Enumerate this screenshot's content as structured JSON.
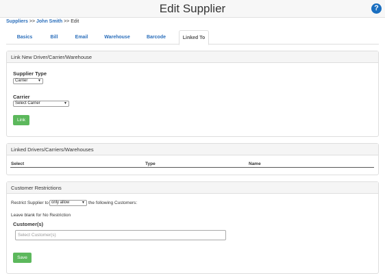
{
  "header": {
    "title": "Edit Supplier",
    "help_icon": "?"
  },
  "breadcrumb": {
    "root": "Suppliers",
    "sep1": ">>",
    "name": "John Smith",
    "sep2": ">> Edit"
  },
  "tabs": [
    {
      "label": "Basics"
    },
    {
      "label": "Bill"
    },
    {
      "label": "Email"
    },
    {
      "label": "Warehouse"
    },
    {
      "label": "Barcode"
    },
    {
      "label": "Linked To",
      "active": true
    }
  ],
  "link_panel": {
    "heading": "Link New Driver/Carrier/Warehouse",
    "supplier_type_label": "Supplier Type",
    "supplier_type_value": "Carrier",
    "carrier_label": "Carrier",
    "carrier_value": "Select Carrier",
    "link_button": "Link"
  },
  "linked_panel": {
    "heading": "Linked Drivers/Carriers/Warehouses",
    "columns": [
      "Select",
      "Type",
      "Name"
    ]
  },
  "restrictions_panel": {
    "heading": "Customer Restrictions",
    "prefix": "Restrict Supplier to",
    "mode_value": "only allow",
    "suffix": "the following Customers:",
    "hint": "Leave blank for No Restriction",
    "customers_label": "Customer(s)",
    "customers_placeholder": "Select Customer(s)",
    "save_button": "Save"
  },
  "colors": {
    "accent": "#2a6ebb",
    "button": "#5cb85c",
    "help": "#1a6fc0"
  }
}
